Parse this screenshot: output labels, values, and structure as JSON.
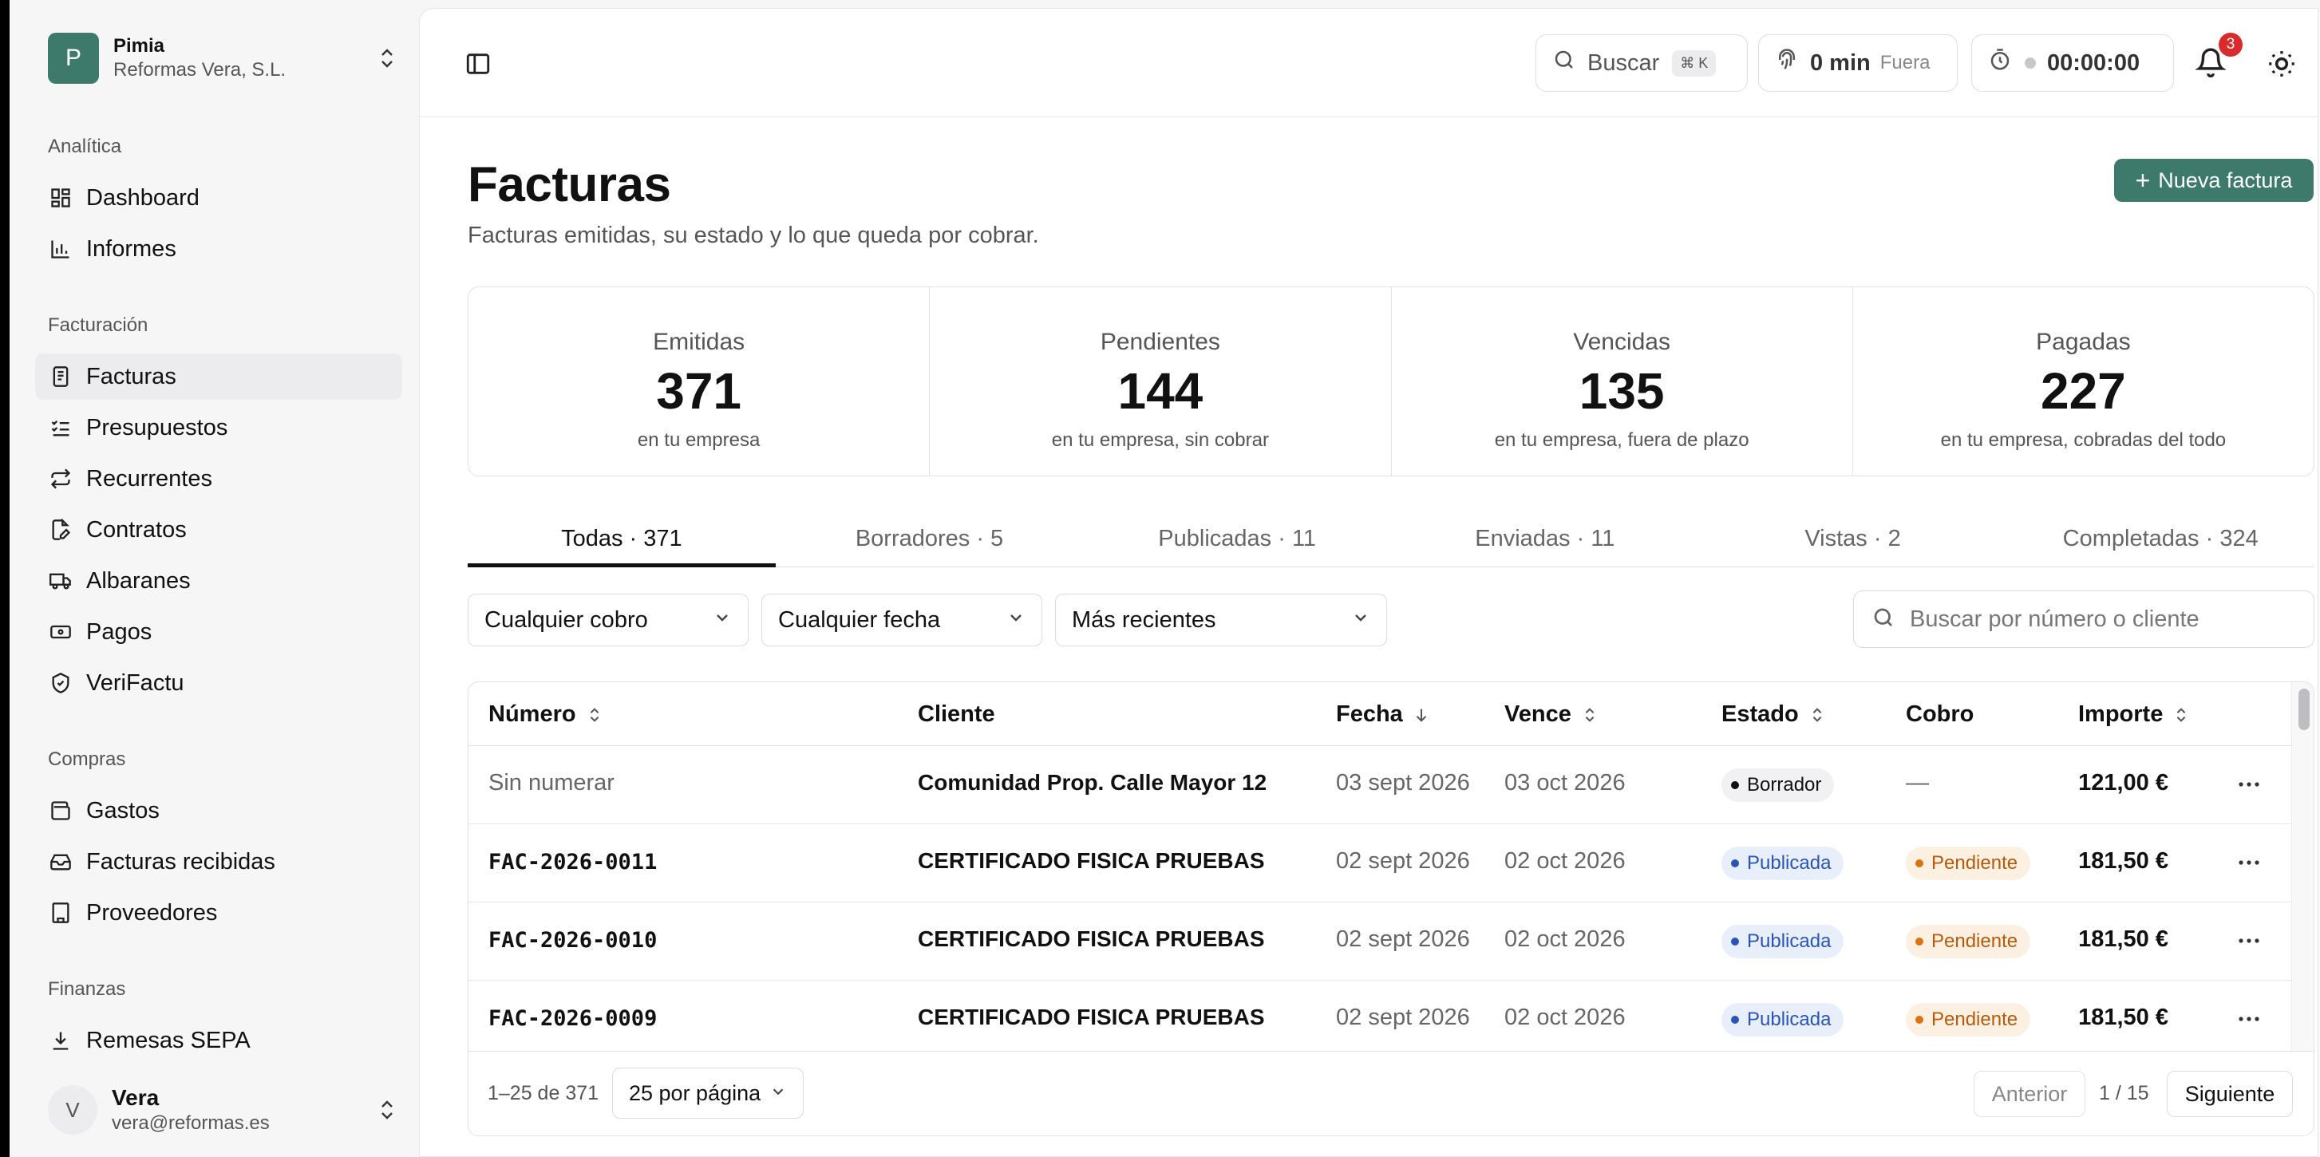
{
  "org": {
    "initial": "P",
    "name": "Pimia",
    "company": "Reformas Vera, S.L."
  },
  "sidebar": {
    "sections": [
      {
        "label": "Analítica"
      },
      {
        "label": "Facturación"
      },
      {
        "label": "Compras"
      },
      {
        "label": "Finanzas"
      }
    ],
    "items": [
      {
        "label": "Dashboard",
        "icon": "dashboard-icon"
      },
      {
        "label": "Informes",
        "icon": "bar-chart-icon"
      },
      {
        "label": "Facturas",
        "icon": "document-icon",
        "active": true
      },
      {
        "label": "Presupuestos",
        "icon": "checklist-icon"
      },
      {
        "label": "Recurrentes",
        "icon": "repeat-icon"
      },
      {
        "label": "Contratos",
        "icon": "file-edit-icon"
      },
      {
        "label": "Albaranes",
        "icon": "truck-icon"
      },
      {
        "label": "Pagos",
        "icon": "banknote-icon"
      },
      {
        "label": "VeriFactu",
        "icon": "shield-check-icon"
      },
      {
        "label": "Gastos",
        "icon": "wallet-icon"
      },
      {
        "label": "Facturas recibidas",
        "icon": "inbox-icon"
      },
      {
        "label": "Proveedores",
        "icon": "building-icon"
      },
      {
        "label": "Remesas SEPA",
        "icon": "download-icon"
      }
    ]
  },
  "user": {
    "initial": "V",
    "name": "Vera",
    "email": "vera@reformas.es"
  },
  "topbar": {
    "search_label": "Buscar",
    "search_shortcut": "⌘ K",
    "time_value": "0 min",
    "time_status": "Fuera",
    "timer": "00:00:00",
    "notifications": "3"
  },
  "page": {
    "title": "Facturas",
    "subtitle": "Facturas emitidas, su estado y lo que queda por cobrar.",
    "new_button": "Nueva factura"
  },
  "stats": [
    {
      "label": "Emitidas",
      "value": "371",
      "sub": "en tu empresa"
    },
    {
      "label": "Pendientes",
      "value": "144",
      "sub": "en tu empresa, sin cobrar"
    },
    {
      "label": "Vencidas",
      "value": "135",
      "sub": "en tu empresa, fuera de plazo"
    },
    {
      "label": "Pagadas",
      "value": "227",
      "sub": "en tu empresa, cobradas del todo"
    }
  ],
  "tabs": [
    {
      "label": "Todas · 371",
      "active": true
    },
    {
      "label": "Borradores · 5"
    },
    {
      "label": "Publicadas · 11"
    },
    {
      "label": "Enviadas · 11"
    },
    {
      "label": "Vistas · 2"
    },
    {
      "label": "Completadas · 324"
    }
  ],
  "filters": {
    "cobro": "Cualquier cobro",
    "fecha": "Cualquier fecha",
    "orden": "Más recientes",
    "search_placeholder": "Buscar por número o cliente"
  },
  "table": {
    "columns": {
      "numero": "Número",
      "cliente": "Cliente",
      "fecha": "Fecha",
      "vence": "Vence",
      "estado": "Estado",
      "cobro": "Cobro",
      "importe": "Importe"
    },
    "rows": [
      {
        "numero": "Sin numerar",
        "cliente": "Comunidad Prop. Calle Mayor 12",
        "fecha": "03 sept 2026",
        "vence": "03 oct 2026",
        "estado": "Borrador",
        "cobro": "—",
        "importe": "121,00 €"
      },
      {
        "numero": "FAC-2026-0011",
        "cliente": "CERTIFICADO FISICA PRUEBAS",
        "fecha": "02 sept 2026",
        "vence": "02 oct 2026",
        "estado": "Publicada",
        "cobro": "Pendiente",
        "importe": "181,50 €"
      },
      {
        "numero": "FAC-2026-0010",
        "cliente": "CERTIFICADO FISICA PRUEBAS",
        "fecha": "02 sept 2026",
        "vence": "02 oct 2026",
        "estado": "Publicada",
        "cobro": "Pendiente",
        "importe": "181,50 €"
      },
      {
        "numero": "FAC-2026-0009",
        "cliente": "CERTIFICADO FISICA PRUEBAS",
        "fecha": "02 sept 2026",
        "vence": "02 oct 2026",
        "estado": "Publicada",
        "cobro": "Pendiente",
        "importe": "181,50 €"
      }
    ]
  },
  "pagination": {
    "range": "1–25 de 371",
    "per_page": "25 por página",
    "prev": "Anterior",
    "page": "1 / 15",
    "next": "Siguiente"
  },
  "colors": {
    "accent": "#3e7a6c",
    "badge": "#d92b2b",
    "published": "#2a55b8",
    "pending": "#d97410"
  }
}
